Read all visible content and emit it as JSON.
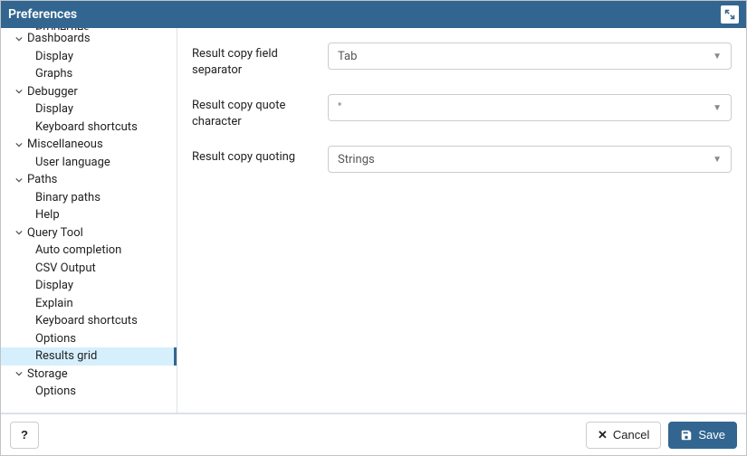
{
  "title": "Preferences",
  "sidebar": {
    "truncated_top": "Properties",
    "items": [
      {
        "label": "Dashboards",
        "expandable": true,
        "depth": 0
      },
      {
        "label": "Display",
        "expandable": false,
        "depth": 1
      },
      {
        "label": "Graphs",
        "expandable": false,
        "depth": 1
      },
      {
        "label": "Debugger",
        "expandable": true,
        "depth": 0
      },
      {
        "label": "Display",
        "expandable": false,
        "depth": 1
      },
      {
        "label": "Keyboard shortcuts",
        "expandable": false,
        "depth": 1
      },
      {
        "label": "Miscellaneous",
        "expandable": true,
        "depth": 0
      },
      {
        "label": "User language",
        "expandable": false,
        "depth": 1
      },
      {
        "label": "Paths",
        "expandable": true,
        "depth": 0
      },
      {
        "label": "Binary paths",
        "expandable": false,
        "depth": 1
      },
      {
        "label": "Help",
        "expandable": false,
        "depth": 1
      },
      {
        "label": "Query Tool",
        "expandable": true,
        "depth": 0
      },
      {
        "label": "Auto completion",
        "expandable": false,
        "depth": 1
      },
      {
        "label": "CSV Output",
        "expandable": false,
        "depth": 1
      },
      {
        "label": "Display",
        "expandable": false,
        "depth": 1
      },
      {
        "label": "Explain",
        "expandable": false,
        "depth": 1
      },
      {
        "label": "Keyboard shortcuts",
        "expandable": false,
        "depth": 1
      },
      {
        "label": "Options",
        "expandable": false,
        "depth": 1
      },
      {
        "label": "Results grid",
        "expandable": false,
        "depth": 1,
        "selected": true
      },
      {
        "label": "Storage",
        "expandable": true,
        "depth": 0
      },
      {
        "label": "Options",
        "expandable": false,
        "depth": 1
      }
    ]
  },
  "form": {
    "rows": [
      {
        "label": "Result copy field separator",
        "value": "Tab"
      },
      {
        "label": "Result copy quote character",
        "value": "\""
      },
      {
        "label": "Result copy quoting",
        "value": "Strings"
      }
    ]
  },
  "footer": {
    "help": "?",
    "cancel": "Cancel",
    "save": "Save"
  }
}
